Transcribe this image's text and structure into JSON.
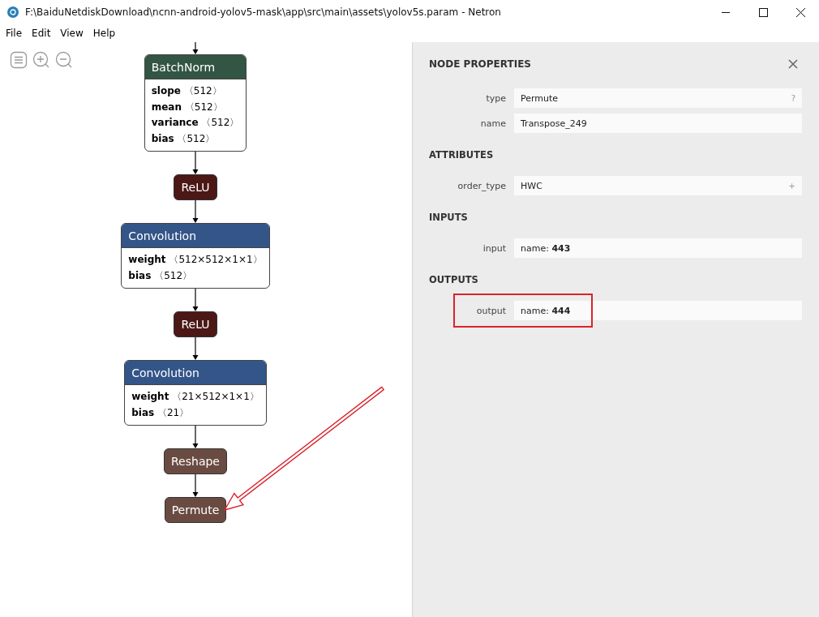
{
  "window": {
    "title": "F:\\BaiduNetdiskDownload\\ncnn-android-yolov5-mask\\app\\src\\main\\assets\\yolov5s.param - Netron"
  },
  "menu": [
    "File",
    "Edit",
    "View",
    "Help"
  ],
  "graph": {
    "nodes": [
      {
        "kind": "normalization",
        "name": "BatchNorm",
        "pointed": false,
        "attributes": [
          {
            "name": "slope",
            "value": "〈512〉"
          },
          {
            "name": "mean",
            "value": "〈512〉"
          },
          {
            "name": "variance",
            "value": "〈512〉"
          },
          {
            "name": "bias",
            "value": "〈512〉"
          }
        ]
      },
      {
        "kind": "activation",
        "name": "ReLU",
        "pointed": false
      },
      {
        "kind": "layer",
        "name": "Convolution",
        "pointed": false,
        "attributes": [
          {
            "name": "weight",
            "value": "〈512×512×1×1〉"
          },
          {
            "name": "bias",
            "value": "〈512〉"
          }
        ]
      },
      {
        "kind": "activation",
        "name": "ReLU",
        "pointed": false
      },
      {
        "kind": "layer",
        "name": "Convolution",
        "pointed": false,
        "attributes": [
          {
            "name": "weight",
            "value": "〈21×512×1×1〉"
          },
          {
            "name": "bias",
            "value": "〈21〉"
          }
        ]
      },
      {
        "kind": "shape",
        "name": "Reshape",
        "pointed": false
      },
      {
        "kind": "shape",
        "name": "Permute",
        "pointed": true
      }
    ]
  },
  "properties": {
    "title": "NODE PROPERTIES",
    "sections": [
      {
        "rows": [
          {
            "label": "type",
            "value": "Permute",
            "action": "?",
            "highlighted": false
          },
          {
            "label": "name",
            "value": "Transpose_249",
            "highlighted": false
          }
        ]
      },
      {
        "title": "ATTRIBUTES",
        "rows": [
          {
            "label": "order_type",
            "value": "HWC",
            "action": "+",
            "highlighted": false
          }
        ]
      },
      {
        "title": "INPUTS",
        "rows": [
          {
            "label": "input",
            "value": "name: **443**",
            "highlighted": false
          }
        ]
      },
      {
        "title": "OUTPUTS",
        "rows": [
          {
            "label": "output",
            "value": "name: **444**",
            "highlighted": true
          }
        ]
      }
    ]
  }
}
